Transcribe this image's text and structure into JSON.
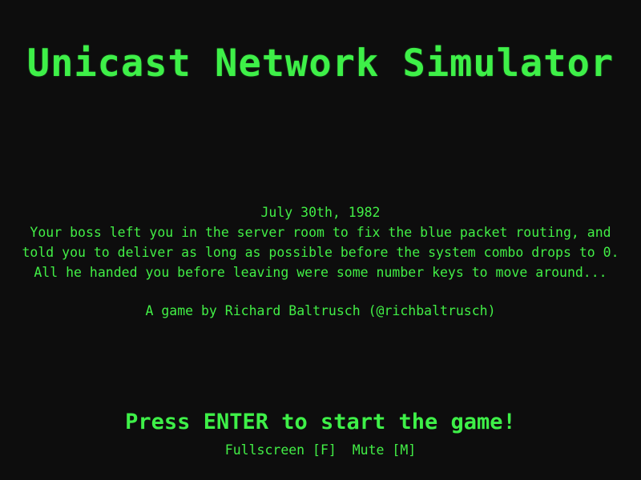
{
  "title": "Unicast Network Simulator",
  "story": {
    "date": "July 30th, 1982",
    "line1": "Your boss left you in the server room to fix the blue packet routing, and",
    "line2": "told you to deliver as long as possible before the system combo drops to 0.",
    "line3": "All he handed you before leaving were some number keys to move around..."
  },
  "credit": "A game by Richard Baltrusch (@richbaltrusch)",
  "prompt": "Press ENTER to start the game!",
  "options": {
    "fullscreen": "Fullscreen [F]",
    "separator": "  ",
    "mute": "Mute [M]"
  },
  "colors": {
    "background": "#0d0d0d",
    "text": "#42ee46"
  }
}
